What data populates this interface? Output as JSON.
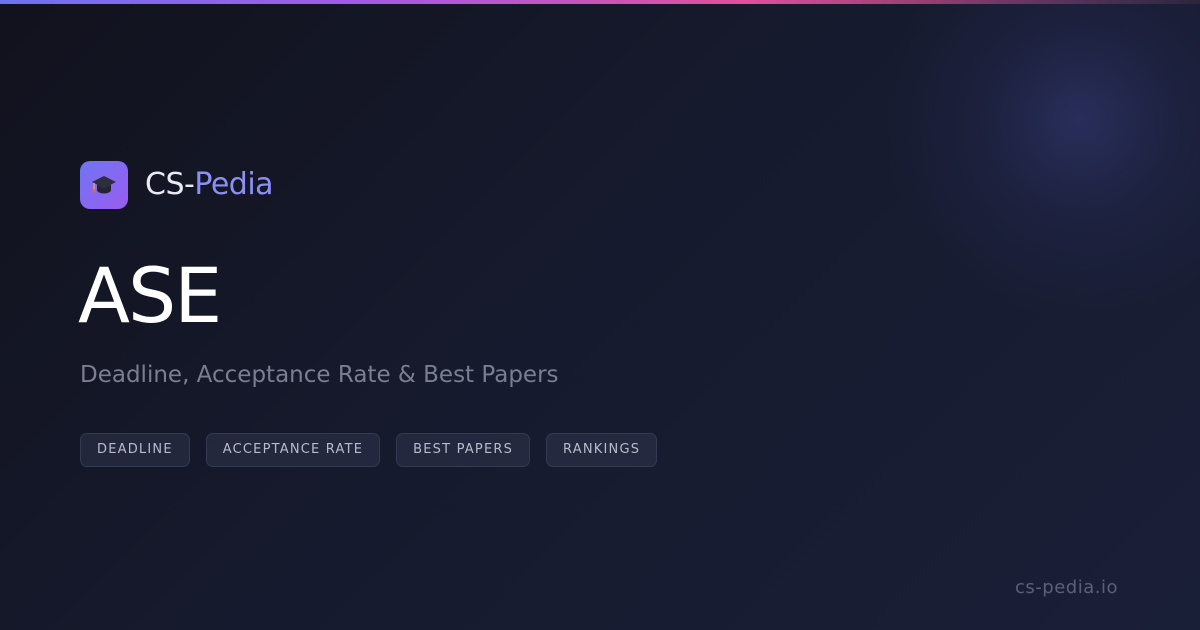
{
  "brand": {
    "logo_icon": "graduation-cap-icon",
    "name_part1": "CS-",
    "name_part2": "Pedia"
  },
  "title": "ASE",
  "subtitle": "Deadline, Acceptance Rate & Best Papers",
  "tags": [
    {
      "label": "DEADLINE"
    },
    {
      "label": "ACCEPTANCE RATE"
    },
    {
      "label": "BEST PAPERS"
    },
    {
      "label": "RANKINGS"
    }
  ],
  "footer": {
    "domain": "cs-pedia.io"
  },
  "colors": {
    "accent": "#8c90f5",
    "logo_gradient_start": "#6f75f2",
    "logo_gradient_end": "#9a5cf0",
    "background": "#161a2d",
    "top_bar_pink": "#e0509c"
  }
}
